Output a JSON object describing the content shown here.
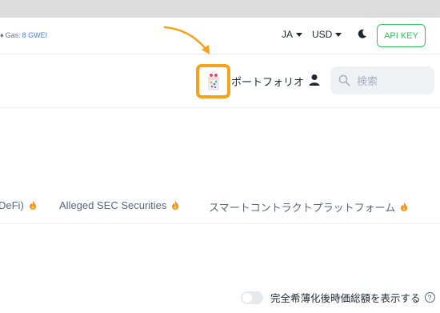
{
  "topbar": {
    "gas_label": "Gas:",
    "gas_value": "8 GWEI",
    "language": "JA",
    "currency": "USD",
    "api_key_label": "API KEY"
  },
  "nav": {
    "portfolio_label": "ポートフォリオ",
    "search_placeholder": "検索"
  },
  "categories": [
    {
      "label": "DeFi)"
    },
    {
      "label": "Alleged SEC Securities"
    },
    {
      "label": "スマートコントラクトプラットフォーム"
    }
  ],
  "settings": {
    "fully_diluted_toggle_label": "完全希薄化後時価総額を表示する",
    "help_glyph": "?"
  },
  "colors": {
    "accent_green": "#32c05f",
    "highlight_orange": "#f7a21b",
    "link_blue": "#3b82f6"
  }
}
